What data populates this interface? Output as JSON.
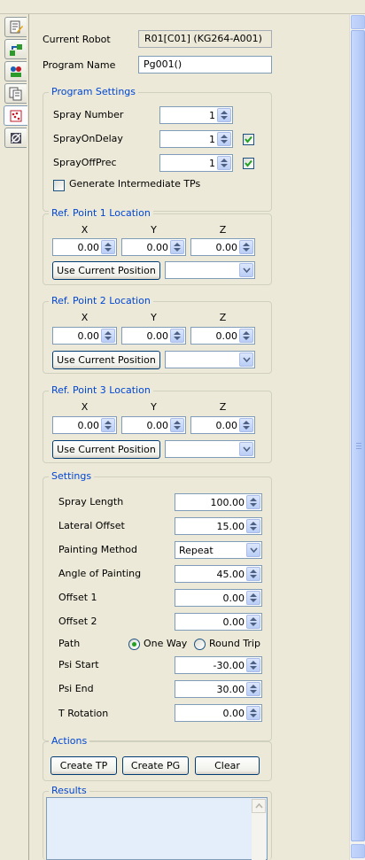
{
  "robot": {
    "label": "Current Robot",
    "value": "R01[C01] (KG264-A001)"
  },
  "program": {
    "label": "Program Name",
    "value": "Pg001()"
  },
  "program_settings": {
    "title": "Program Settings",
    "spray_number": {
      "label": "Spray Number",
      "value": "1"
    },
    "spray_on_delay": {
      "label": "SprayOnDelay",
      "value": "1",
      "checked": true
    },
    "spray_off_prec": {
      "label": "SprayOffPrec",
      "value": "1",
      "checked": true
    },
    "generate": {
      "label": "Generate Intermediate TPs",
      "checked": false
    }
  },
  "ref_points": [
    {
      "title": "Ref. Point 1 Location",
      "x_label": "X",
      "y_label": "Y",
      "z_label": "Z",
      "x": "0.00",
      "y": "0.00",
      "z": "0.00",
      "button": "Use Current Position",
      "select": ""
    },
    {
      "title": "Ref. Point 2 Location",
      "x_label": "X",
      "y_label": "Y",
      "z_label": "Z",
      "x": "0.00",
      "y": "0.00",
      "z": "0.00",
      "button": "Use Current Position",
      "select": ""
    },
    {
      "title": "Ref. Point 3 Location",
      "x_label": "X",
      "y_label": "Y",
      "z_label": "Z",
      "x": "0.00",
      "y": "0.00",
      "z": "0.00",
      "button": "Use Current Position",
      "select": ""
    }
  ],
  "settings": {
    "title": "Settings",
    "spray_length": {
      "label": "Spray Length",
      "value": "100.00"
    },
    "lateral_offset": {
      "label": "Lateral Offset",
      "value": "15.00"
    },
    "painting_method": {
      "label": "Painting Method",
      "value": "Repeat"
    },
    "angle": {
      "label": "Angle of Painting",
      "value": "45.00"
    },
    "offset1": {
      "label": "Offset 1",
      "value": "0.00"
    },
    "offset2": {
      "label": "Offset 2",
      "value": "0.00"
    },
    "path": {
      "label": "Path",
      "option1": "One Way",
      "option2": "Round Trip",
      "selected": "One Way"
    },
    "psi_start": {
      "label": "Psi Start",
      "value": "-30.00"
    },
    "psi_end": {
      "label": "Psi End",
      "value": "30.00"
    },
    "t_rotation": {
      "label": "T Rotation",
      "value": "0.00"
    }
  },
  "actions": {
    "title": "Actions",
    "create_tp": "Create TP",
    "create_pg": "Create PG",
    "clear": "Clear"
  },
  "results": {
    "title": "Results",
    "text": ""
  },
  "side_tabs": [
    "edit-document-icon",
    "robot-transfer-icon",
    "robots-group-icon",
    "copy-list-icon",
    "spray-pattern-icon",
    "tool-calibration-icon"
  ],
  "colors": {
    "group_title": "#0046d5",
    "check": "#21a121",
    "window_bg": "#ece9d8"
  }
}
